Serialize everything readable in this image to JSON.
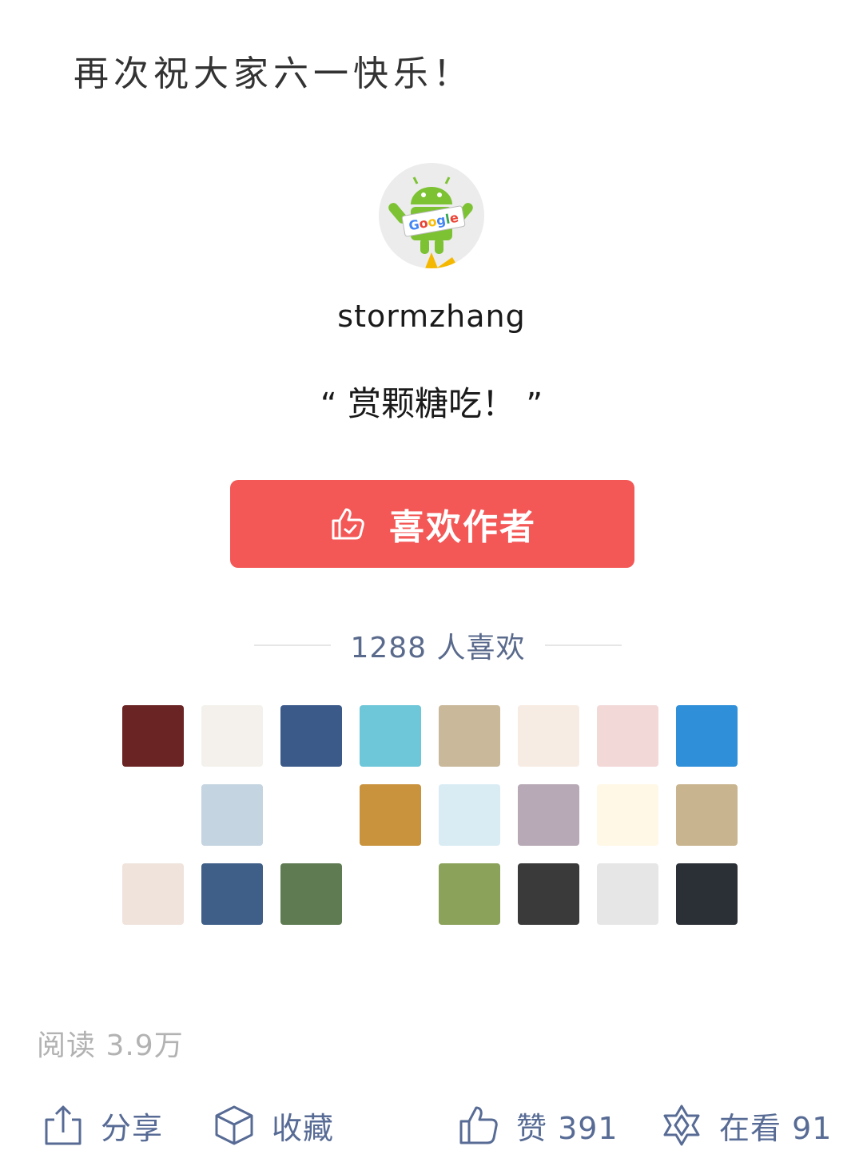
{
  "article": {
    "closing_text": "再次祝大家六一快乐！"
  },
  "reward": {
    "author_name": "stormzhang",
    "avatar_label": "Google",
    "quote_open": "“",
    "quote_text": "赏颗糖吃！",
    "quote_close": "”",
    "button_label": "喜欢作者",
    "button_icon": "thumbs-up-check-icon",
    "likes_count_text": "1288 人喜欢",
    "supporter_avatars": [
      {
        "name": "avatar-1",
        "bg": "#6b2424"
      },
      {
        "name": "avatar-2",
        "bg": "#f4f1ec"
      },
      {
        "name": "avatar-3",
        "bg": "#3b5a8a"
      },
      {
        "name": "avatar-4",
        "bg": "#6ec6d9"
      },
      {
        "name": "avatar-5",
        "bg": "#c9b89a"
      },
      {
        "name": "avatar-6",
        "bg": "#f7ece3"
      },
      {
        "name": "avatar-7",
        "bg": "#f3d8d8"
      },
      {
        "name": "avatar-8",
        "bg": "#2f8fd8"
      },
      {
        "name": "avatar-9",
        "bg": "#ffffff"
      },
      {
        "name": "avatar-10",
        "bg": "#c4d4e0"
      },
      {
        "name": "avatar-11",
        "bg": "#ffffff"
      },
      {
        "name": "avatar-12",
        "bg": "#c9923c"
      },
      {
        "name": "avatar-13",
        "bg": "#d9ecf4"
      },
      {
        "name": "avatar-14",
        "bg": "#b7a9b5"
      },
      {
        "name": "avatar-15",
        "bg": "#fff8e6"
      },
      {
        "name": "avatar-16",
        "bg": "#c8b48e"
      },
      {
        "name": "avatar-17",
        "bg": "#efe3dc"
      },
      {
        "name": "avatar-18",
        "bg": "#3f5f88"
      },
      {
        "name": "avatar-19",
        "bg": "#5e7b52"
      },
      {
        "name": "avatar-20",
        "bg": "#ffffff"
      },
      {
        "name": "avatar-21",
        "bg": "#8aa25a"
      },
      {
        "name": "avatar-22",
        "bg": "#3a3a3a"
      },
      {
        "name": "avatar-23",
        "bg": "#e6e6e6"
      },
      {
        "name": "avatar-24",
        "bg": "#2b2f36"
      }
    ]
  },
  "stats": {
    "reads_text": "阅读 3.9万"
  },
  "actions": [
    {
      "name": "share",
      "label": "分享",
      "icon": "share-icon"
    },
    {
      "name": "favorite",
      "label": "收藏",
      "icon": "cube-icon"
    },
    {
      "name": "like",
      "label": "赞 391",
      "icon": "thumbs-up-icon"
    },
    {
      "name": "wow",
      "label": "在看 91",
      "icon": "flower-icon"
    }
  ],
  "colors": {
    "button_bg": "#f35756",
    "link_blue": "#576b95",
    "muted_gray": "#b2b2b2",
    "likes_text": "#5a6a8c"
  }
}
